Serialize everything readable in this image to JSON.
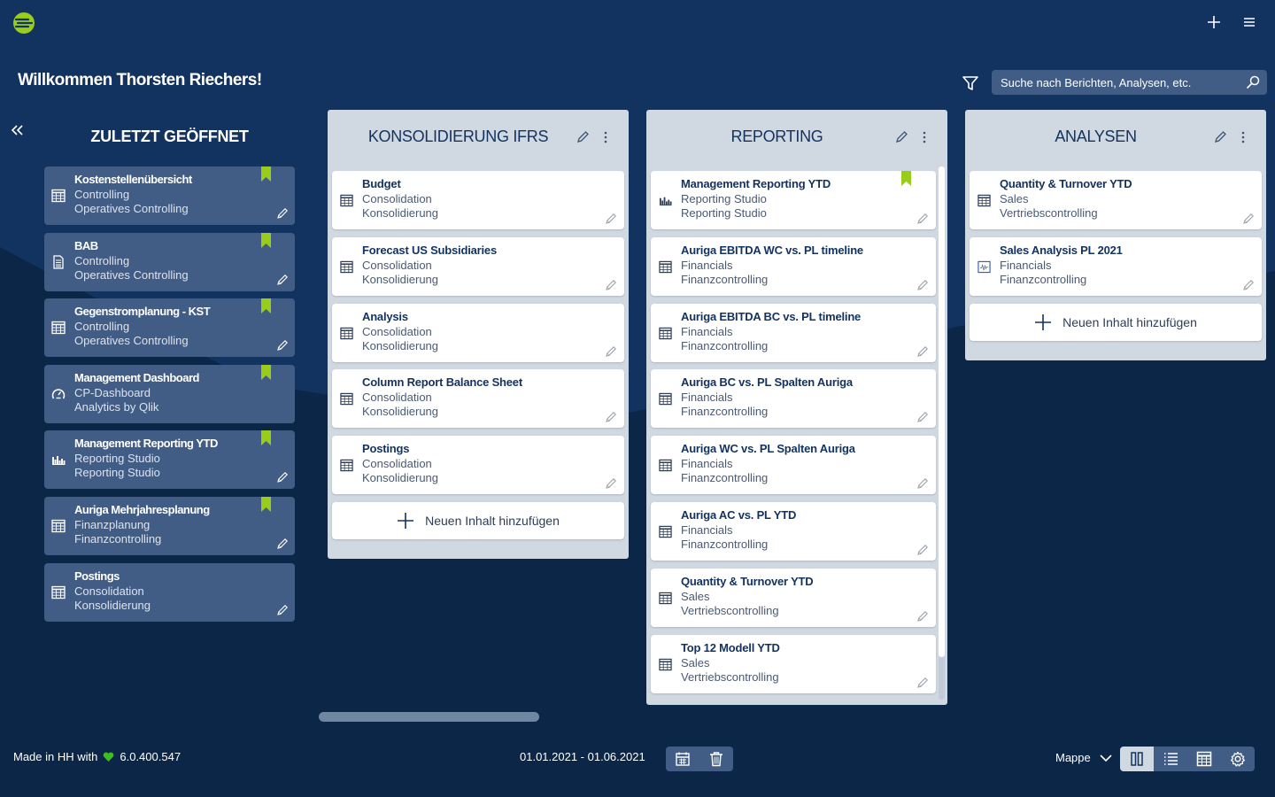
{
  "app": {
    "welcome": "Willkommen Thorsten Riechers!",
    "colors": {
      "accent": "#9acd1a",
      "background": "#12325f",
      "background_dark": "#0c2648",
      "card_dark": "#425d85",
      "column": "#d0d8e2"
    }
  },
  "search": {
    "placeholder": "Suche nach Berichten, Analysen, etc.",
    "value": ""
  },
  "recent": {
    "title": "ZULETZT GEÖFFNET",
    "items": [
      {
        "title": "Kostenstellenübersicht",
        "line2": "Controlling",
        "line3": "Operatives Controlling",
        "icon": "table-icon",
        "bookmarked": true,
        "editable": true
      },
      {
        "title": "BAB",
        "line2": "Controlling",
        "line3": "Operatives Controlling",
        "icon": "document-icon",
        "bookmarked": true,
        "editable": true
      },
      {
        "title": "Gegenstromplanung - KST",
        "line2": "Controlling",
        "line3": "Operatives Controlling",
        "icon": "table-icon",
        "bookmarked": true,
        "editable": true
      },
      {
        "title": "Management Dashboard",
        "line2": "CP-Dashboard",
        "line3": "Analytics by Qlik",
        "icon": "dashboard-icon",
        "bookmarked": true,
        "editable": false
      },
      {
        "title": "Management Reporting YTD",
        "line2": "Reporting Studio",
        "line3": "Reporting Studio",
        "icon": "bar-chart-icon",
        "bookmarked": true,
        "editable": true
      },
      {
        "title": "Auriga Mehrjahresplanung",
        "line2": "Finanzplanung",
        "line3": "Finanzcontrolling",
        "icon": "table-icon",
        "bookmarked": true,
        "editable": true
      },
      {
        "title": "Postings",
        "line2": "Consolidation",
        "line3": "Konsolidierung",
        "icon": "table-icon",
        "bookmarked": false,
        "editable": true
      }
    ]
  },
  "columns": [
    {
      "title": "KONSOLIDIERUNG IFRS",
      "add_label": "Neuen Inhalt hinzufügen",
      "items": [
        {
          "title": "Budget",
          "line2": "Consolidation",
          "line3": "Konsolidierung",
          "icon": "table-icon",
          "bookmarked": false
        },
        {
          "title": "Forecast US Subsidiaries",
          "line2": "Consolidation",
          "line3": "Konsolidierung",
          "icon": "table-icon",
          "bookmarked": false
        },
        {
          "title": "Analysis",
          "line2": "Consolidation",
          "line3": "Konsolidierung",
          "icon": "table-icon",
          "bookmarked": false
        },
        {
          "title": "Column Report Balance Sheet",
          "line2": "Consolidation",
          "line3": "Konsolidierung",
          "icon": "table-icon",
          "bookmarked": false
        },
        {
          "title": "Postings",
          "line2": "Consolidation",
          "line3": "Konsolidierung",
          "icon": "table-icon",
          "bookmarked": false
        }
      ]
    },
    {
      "title": "REPORTING",
      "add_label": "",
      "items": [
        {
          "title": "Management Reporting YTD",
          "line2": "Reporting Studio",
          "line3": "Reporting Studio",
          "icon": "bar-chart-icon",
          "bookmarked": true
        },
        {
          "title": "Auriga EBITDA WC vs. PL timeline",
          "line2": "Financials",
          "line3": "Finanzcontrolling",
          "icon": "table-icon",
          "bookmarked": false
        },
        {
          "title": "Auriga EBITDA BC vs. PL timeline",
          "line2": "Financials",
          "line3": "Finanzcontrolling",
          "icon": "table-icon",
          "bookmarked": false
        },
        {
          "title": "Auriga BC vs. PL Spalten Auriga",
          "line2": "Financials",
          "line3": "Finanzcontrolling",
          "icon": "table-icon",
          "bookmarked": false
        },
        {
          "title": "Auriga WC vs. PL Spalten Auriga",
          "line2": "Financials",
          "line3": "Finanzcontrolling",
          "icon": "table-icon",
          "bookmarked": false
        },
        {
          "title": "Auriga AC vs. PL YTD",
          "line2": "Financials",
          "line3": "Finanzcontrolling",
          "icon": "table-icon",
          "bookmarked": false
        },
        {
          "title": "Quantity & Turnover YTD",
          "line2": "Sales",
          "line3": "Vertriebscontrolling",
          "icon": "table-icon",
          "bookmarked": false
        },
        {
          "title": "Top 12 Modell YTD",
          "line2": "Sales",
          "line3": "Vertriebscontrolling",
          "icon": "table-icon",
          "bookmarked": false
        }
      ]
    },
    {
      "title": "ANALYSEN",
      "add_label": "Neuen Inhalt hinzufügen",
      "items": [
        {
          "title": "Quantity & Turnover YTD",
          "line2": "Sales",
          "line3": "Vertriebscontrolling",
          "icon": "table-icon",
          "bookmarked": false
        },
        {
          "title": "Sales Analysis PL 2021",
          "line2": "Financials",
          "line3": "Finanzcontrolling",
          "icon": "analysis-chart-icon",
          "bookmarked": false
        }
      ]
    }
  ],
  "footer": {
    "made_in": "Made in HH with",
    "version": "6.0.400.547",
    "date_range": "01.01.2021 - 01.06.2021",
    "folder_select": "Mappe",
    "active_view": "columns-view"
  }
}
